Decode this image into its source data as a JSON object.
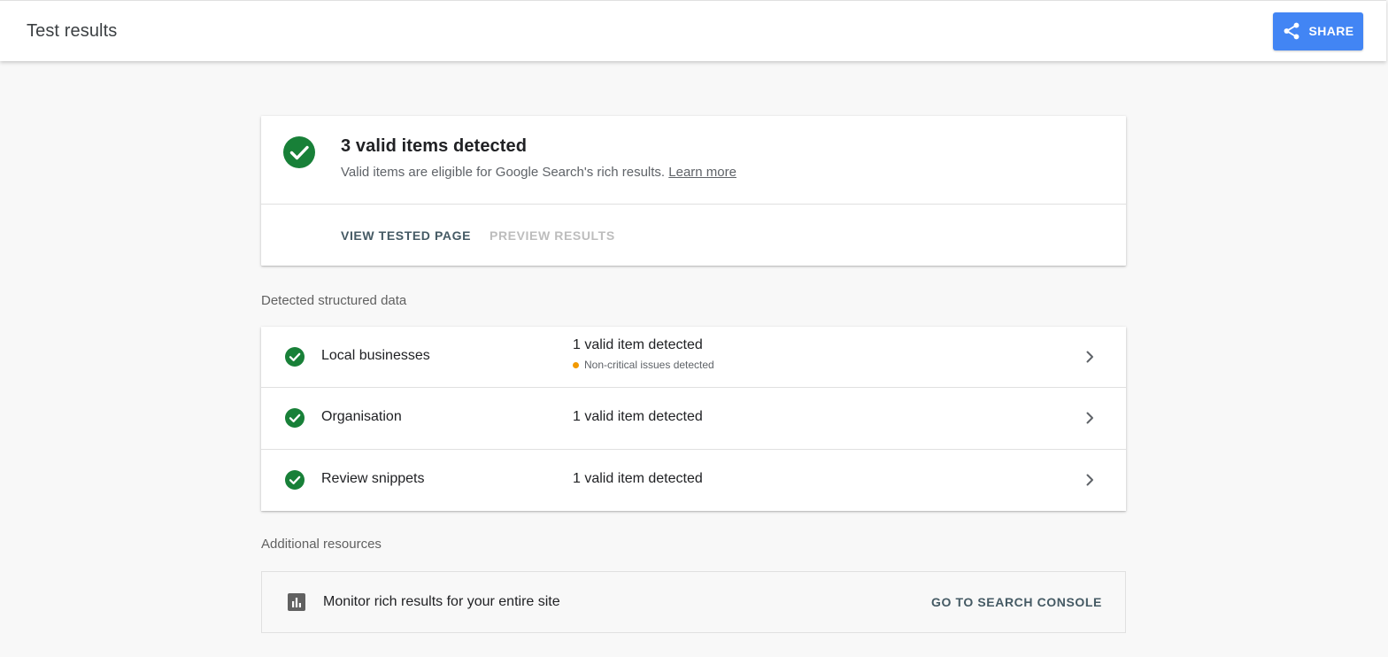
{
  "header": {
    "title": "Test results",
    "share_label": "SHARE"
  },
  "summary": {
    "headline": "3 valid items detected",
    "description": "Valid items are eligible for Google Search's rich results.",
    "learn_more": "Learn more",
    "view_tested_page": "VIEW TESTED PAGE",
    "preview_results": "PREVIEW RESULTS"
  },
  "detected": {
    "section_label": "Detected structured data",
    "items": [
      {
        "name": "Local businesses",
        "status": "1 valid item detected",
        "issue": "Non-critical issues detected"
      },
      {
        "name": "Organisation",
        "status": "1 valid item detected"
      },
      {
        "name": "Review snippets",
        "status": "1 valid item detected"
      }
    ]
  },
  "resources": {
    "section_label": "Additional resources",
    "monitor_text": "Monitor rich results for your entire site",
    "console_link": "GO TO SEARCH CONSOLE"
  },
  "colors": {
    "accent_blue": "#4285f4",
    "valid_green": "#188038",
    "warning_orange": "#f29900",
    "action_gray": "#455a64",
    "disabled_gray": "#bdbdbd"
  },
  "icons": {
    "share": "share-icon",
    "valid": "check-circle-icon",
    "chevron": "chevron-right-icon",
    "chart": "bar-chart-icon"
  }
}
